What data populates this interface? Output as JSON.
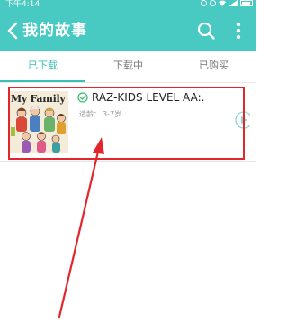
{
  "status_bar": {
    "time": "下午4:14"
  },
  "app_bar": {
    "title": "我的故事"
  },
  "tabs": [
    {
      "label": "已下载",
      "active": true
    },
    {
      "label": "下载中",
      "active": false
    },
    {
      "label": "已购买",
      "active": false
    }
  ],
  "items": [
    {
      "thumbnail_text": "My Family",
      "title": "RAZ-KIDS LEVEL AA:.",
      "age_label": "适龄：",
      "age_value": "3-7岁"
    }
  ],
  "colors": {
    "accent": "#48c9c1",
    "highlight": "#e3262b"
  },
  "icons": [
    "back-icon",
    "search-icon",
    "more-icon",
    "check-circle-icon",
    "play-icon"
  ]
}
